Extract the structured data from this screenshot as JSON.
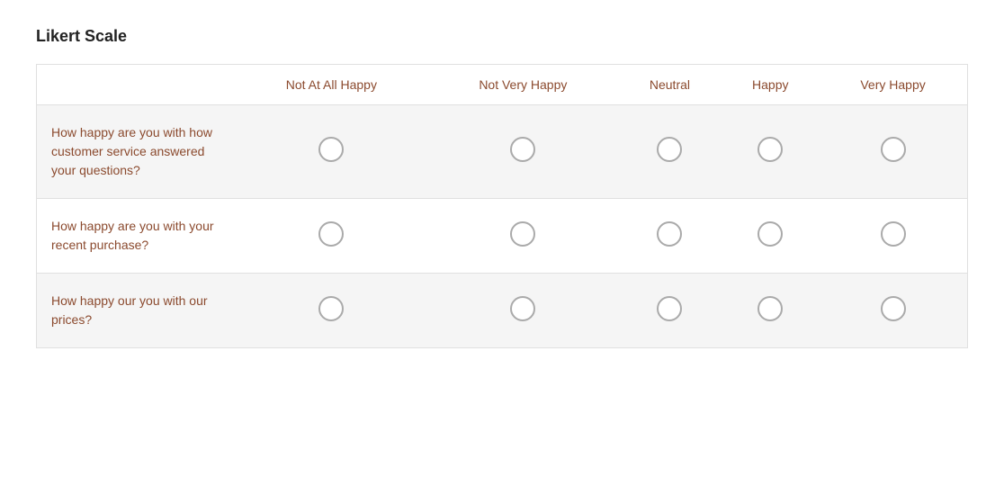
{
  "title": "Likert Scale",
  "columns": [
    {
      "id": "question",
      "label": ""
    },
    {
      "id": "not_at_all_happy",
      "label": "Not At All Happy"
    },
    {
      "id": "not_very_happy",
      "label": "Not Very Happy"
    },
    {
      "id": "neutral",
      "label": "Neutral"
    },
    {
      "id": "happy",
      "label": "Happy"
    },
    {
      "id": "very_happy",
      "label": "Very Happy"
    }
  ],
  "rows": [
    {
      "question": "How happy are you with how customer service answered your questions?"
    },
    {
      "question": "How happy are you with your recent purchase?"
    },
    {
      "question": "How happy our you with our prices?"
    }
  ]
}
